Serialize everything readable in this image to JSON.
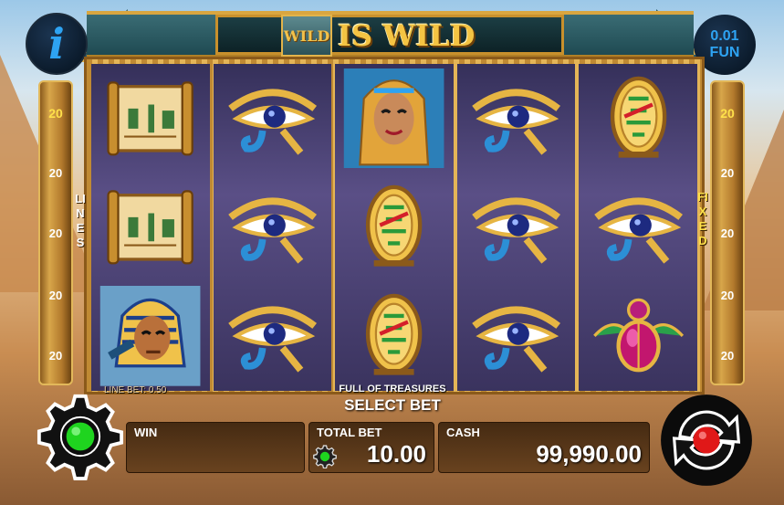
{
  "banner": {
    "wild_tile": "WILD",
    "title": "IS WILD"
  },
  "info_button": {
    "glyph": "i"
  },
  "denomination": {
    "value": "0.01",
    "currency": "FUN"
  },
  "lines_panel": {
    "label": "LINES",
    "numbers": [
      "20",
      "20",
      "20",
      "20",
      "20"
    ]
  },
  "fixed_panel": {
    "label": "FIXED",
    "numbers": [
      "20",
      "20",
      "20",
      "20",
      "20"
    ]
  },
  "reels": [
    [
      "scroll-icon",
      "scroll-icon",
      "pharaoh-icon"
    ],
    [
      "eye-of-horus-icon",
      "eye-of-horus-icon",
      "eye-of-horus-icon"
    ],
    [
      "cleopatra-icon",
      "cartouche-icon",
      "cartouche-icon"
    ],
    [
      "eye-of-horus-icon",
      "eye-of-horus-icon",
      "eye-of-horus-icon"
    ],
    [
      "cartouche-icon",
      "eye-of-horus-icon",
      "scarab-icon"
    ]
  ],
  "line_bet": "LINE BET: 0.50",
  "game_name": "FULL OF TREASURES",
  "select_bet": "SELECT BET",
  "win": {
    "label": "WIN",
    "value": ""
  },
  "total_bet": {
    "label": "TOTAL BET",
    "value": "10.00"
  },
  "cash": {
    "label": "CASH",
    "value": "99,990.00"
  },
  "colors": {
    "accent_gold": "#f4c443",
    "info_blue": "#2ea3f2",
    "settings_green": "#1fd41f",
    "spin_red": "#e01818"
  }
}
